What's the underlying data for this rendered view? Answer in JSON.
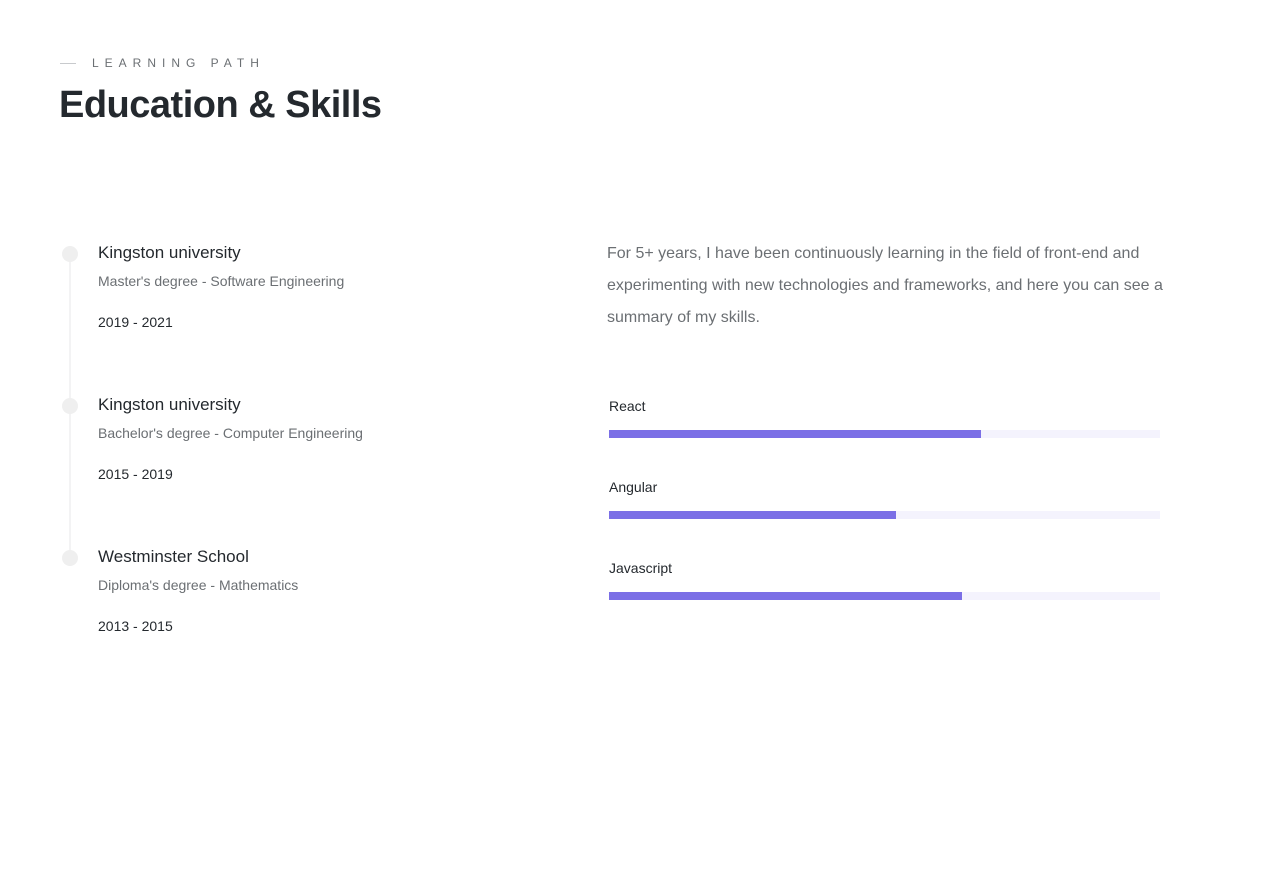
{
  "header": {
    "eyebrow": "LEARNING PATH",
    "title": "Education & Skills"
  },
  "education": [
    {
      "school": "Kingston university",
      "degree": "Master's degree - Software Engineering",
      "years": "2019 - 2021"
    },
    {
      "school": "Kingston university",
      "degree": "Bachelor's degree - Computer Engineering",
      "years": "2015 - 2019"
    },
    {
      "school": "Westminster School",
      "degree": "Diploma's degree - Mathematics",
      "years": "2013 - 2015"
    }
  ],
  "summary": "For 5+ years, I have been continuously learning in the field of front-end and experimenting with new technologies and frameworks, and here you can see a summary of my skills.",
  "skills": [
    {
      "name": "React",
      "level": 0.675
    },
    {
      "name": "Angular",
      "level": 0.52
    },
    {
      "name": "Javascript",
      "level": 0.64
    }
  ],
  "colors": {
    "accent": "#7b6fe6",
    "track": "#f4f3fd",
    "heading": "#24292e",
    "muted": "#6b6f73"
  }
}
